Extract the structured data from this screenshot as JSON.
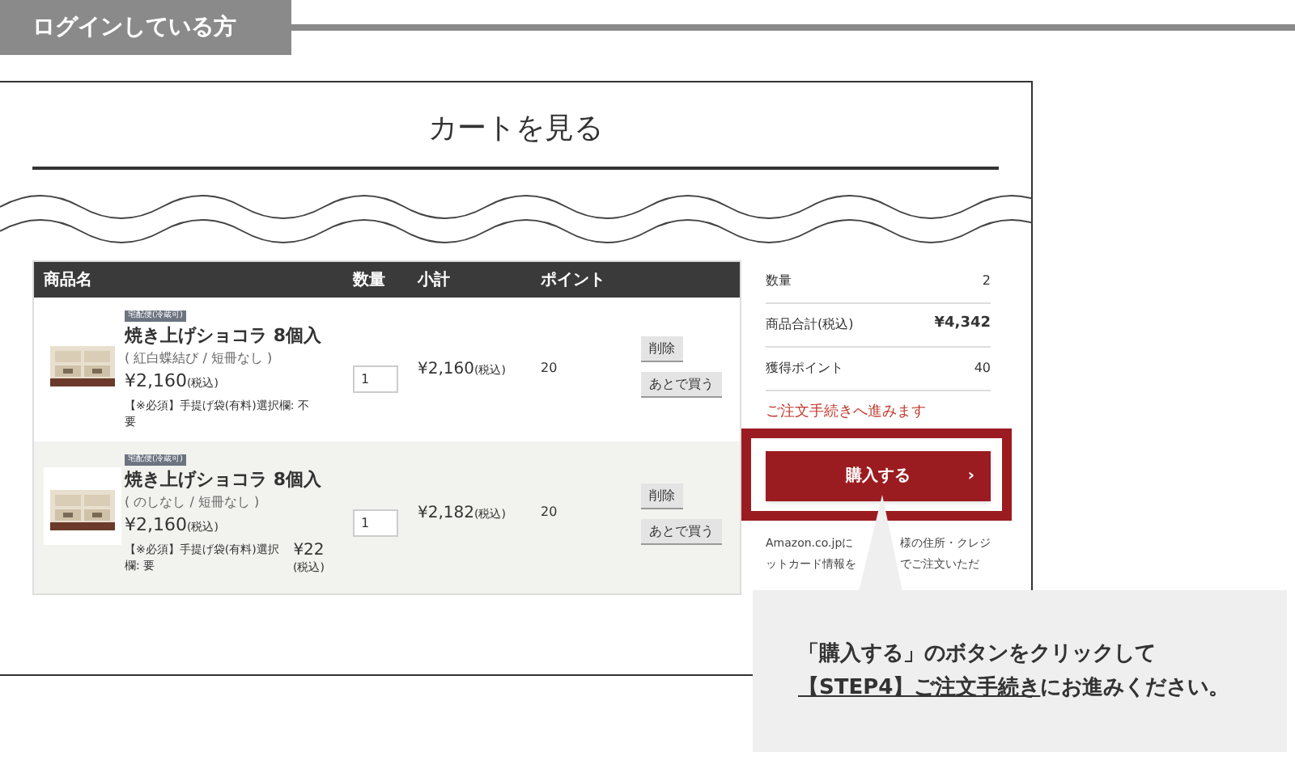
{
  "section_tag": "ログインしている方",
  "page_title": "カートを見る",
  "table": {
    "columns": [
      "商品名",
      "数量",
      "小計",
      "ポイント"
    ],
    "rows": [
      {
        "tag": "宅配便(冷蔵可)",
        "name": "焼き上げショコラ 8個入",
        "options": "( 紅白蝶結び / 短冊なし )",
        "price": "¥2,160",
        "price_tax": "(税込)",
        "note": "【※必須】手提げ袋(有料)選択欄: 不要",
        "quantity": "1",
        "subtotal": "¥2,160",
        "subtotal_tax": "(税込)",
        "points": "20",
        "buttons": [
          "削除",
          "あとで買う"
        ]
      },
      {
        "tag": "宅配便(冷蔵可)",
        "name": "焼き上げショコラ 8個入",
        "options": "( のしなし / 短冊なし )",
        "price": "¥2,160",
        "price_tax": "(税込)",
        "note": "【※必須】手提げ袋(有料)選択欄: 要",
        "extra_price": "¥22",
        "extra_tax": "(税込)",
        "quantity": "1",
        "subtotal": "¥2,182",
        "subtotal_tax": "(税込)",
        "points": "20",
        "buttons": [
          "削除",
          "あとで買う"
        ]
      }
    ]
  },
  "summary": {
    "rows": [
      {
        "label": "数量",
        "value": "2",
        "bold": false
      },
      {
        "label": "商品合計(税込)",
        "value": "¥4,342",
        "bold": true
      },
      {
        "label": "獲得ポイント",
        "value": "40",
        "bold": false
      }
    ],
    "notice": "ご注文手続きへ進みます",
    "purchase_button": "購入する",
    "purchase_arrow": "›",
    "amazon_left": [
      "Amazon.co.jpに",
      "ットカード情報を"
    ],
    "amazon_right": [
      "様の住所・クレジ",
      "でご注文いただ"
    ]
  },
  "callout": {
    "line1": "「購入する」のボタンをクリックして",
    "link": "【STEP4】ご注文手続き",
    "line2_rest": "にお進みください。"
  }
}
